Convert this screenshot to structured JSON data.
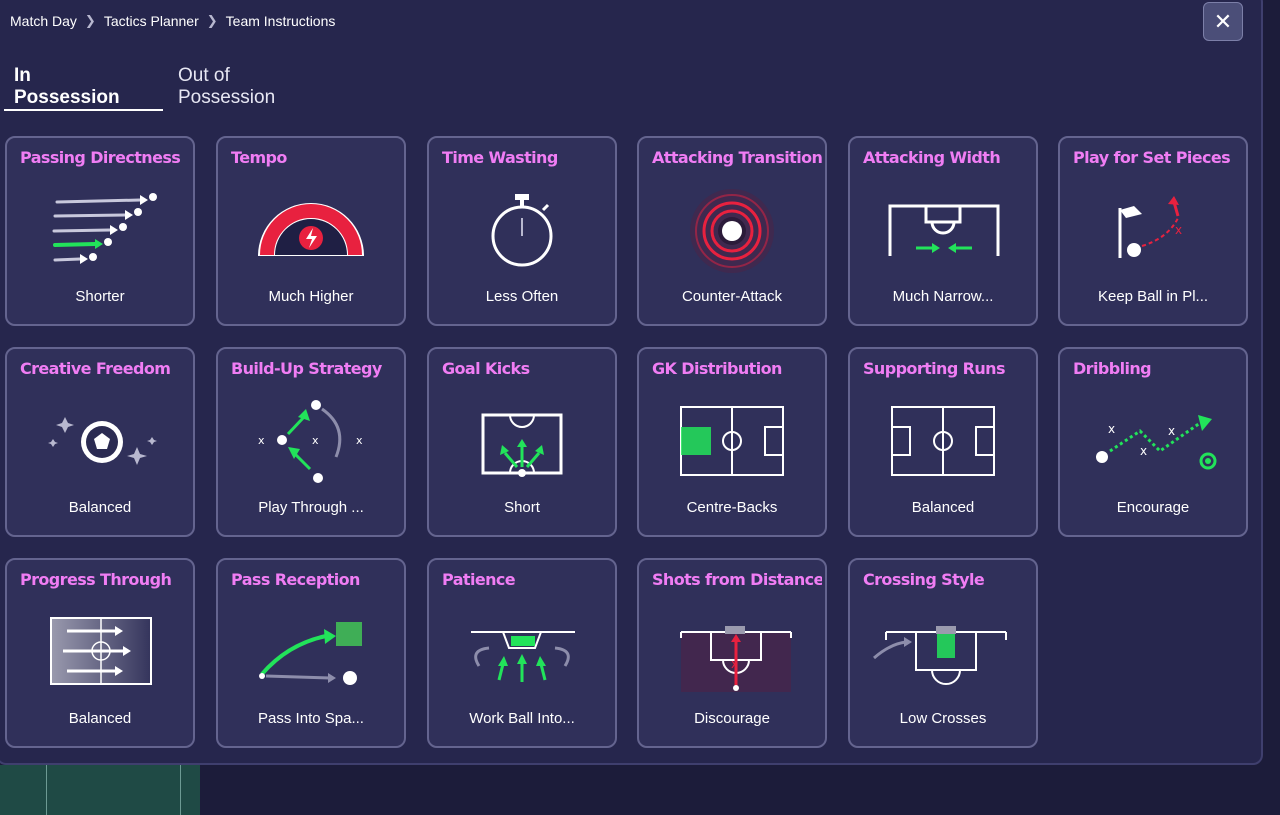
{
  "breadcrumb": {
    "items": [
      "Match Day",
      "Tactics Planner",
      "Team Instructions"
    ]
  },
  "close_button": {
    "label": "✕"
  },
  "tabs": [
    {
      "label": "In Possession",
      "active": true
    },
    {
      "label": "Out of Possession",
      "active": false
    }
  ],
  "colors": {
    "title_pink": "#f07df4",
    "accent_green": "#22e35a",
    "accent_red": "#e8213f",
    "card_bg": "#30305a",
    "panel_bg": "#26264d"
  },
  "cards": [
    {
      "title": "Passing Directness",
      "value": "Shorter",
      "icon": "passing-arrows-icon"
    },
    {
      "title": "Tempo",
      "value": "Much Higher",
      "icon": "tempo-gauge-icon"
    },
    {
      "title": "Time Wasting",
      "value": "Less Often",
      "icon": "stopwatch-icon"
    },
    {
      "title": "Attacking Transition",
      "value": "Counter-Attack",
      "icon": "target-rings-icon"
    },
    {
      "title": "Attacking Width",
      "value": "Much Narrow...",
      "icon": "narrow-pitch-icon"
    },
    {
      "title": "Play for Set Pieces",
      "value": "Keep Ball in Pl...",
      "icon": "corner-flag-icon"
    },
    {
      "title": "Creative Freedom",
      "value": "Balanced",
      "icon": "sparkle-ball-icon"
    },
    {
      "title": "Build-Up Strategy",
      "value": "Play Through ...",
      "icon": "build-up-arrows-icon"
    },
    {
      "title": "Goal Kicks",
      "value": "Short",
      "icon": "goal-kick-box-icon"
    },
    {
      "title": "GK Distribution",
      "value": "Centre-Backs",
      "icon": "gk-pitch-icon"
    },
    {
      "title": "Supporting Runs",
      "value": "Balanced",
      "icon": "pitch-icon"
    },
    {
      "title": "Dribbling",
      "value": "Encourage",
      "icon": "dribble-path-icon"
    },
    {
      "title": "Progress Through",
      "value": "Balanced",
      "icon": "progress-pitch-icon"
    },
    {
      "title": "Pass Reception",
      "value": "Pass Into Spa...",
      "icon": "pass-into-space-icon"
    },
    {
      "title": "Patience",
      "value": "Work Ball Into...",
      "icon": "patience-box-icon"
    },
    {
      "title": "Shots from Distance",
      "value": "Discourage",
      "icon": "penalty-box-icon"
    },
    {
      "title": "Crossing Style",
      "value": "Low Crosses",
      "icon": "crossing-box-icon"
    }
  ]
}
